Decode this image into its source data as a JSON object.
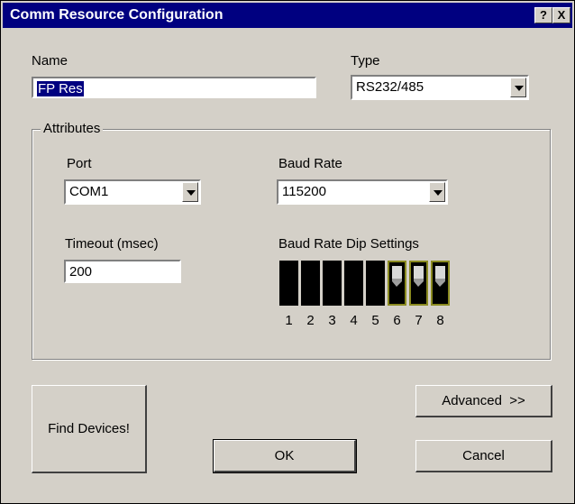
{
  "window": {
    "title": "Comm Resource Configuration",
    "help_label": "?",
    "close_label": "X"
  },
  "name": {
    "label": "Name",
    "value": "FP Res"
  },
  "type": {
    "label": "Type",
    "value": "RS232/485"
  },
  "attributes": {
    "label": "Attributes",
    "port": {
      "label": "Port",
      "value": "COM1"
    },
    "baud_rate": {
      "label": "Baud Rate",
      "value": "115200"
    },
    "timeout": {
      "label": "Timeout (msec)",
      "value": "200"
    },
    "dip": {
      "label": "Baud Rate Dip Settings",
      "switches": [
        {
          "number": "1",
          "on": false
        },
        {
          "number": "2",
          "on": false
        },
        {
          "number": "3",
          "on": false
        },
        {
          "number": "4",
          "on": false
        },
        {
          "number": "5",
          "on": false
        },
        {
          "number": "6",
          "on": true
        },
        {
          "number": "7",
          "on": true
        },
        {
          "number": "8",
          "on": true
        }
      ]
    }
  },
  "buttons": {
    "find_devices": "Find Devices!",
    "advanced": "Advanced  >>",
    "ok": "OK",
    "cancel": "Cancel"
  },
  "colors": {
    "titlebar": "#000080",
    "face": "#d4d0c8",
    "dip_on_border": "#8a8a20"
  }
}
